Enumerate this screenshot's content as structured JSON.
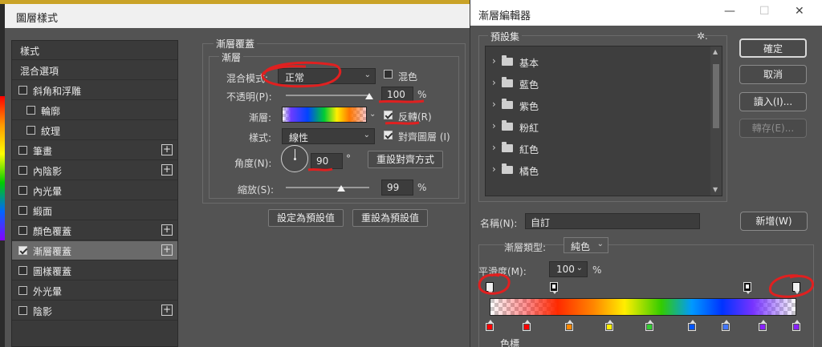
{
  "colors": {
    "accent_red": "#e02020",
    "checkbox_on": "#e8e8e8"
  },
  "layer_style": {
    "title": "圖層樣式",
    "styles_list": [
      {
        "label": "樣式",
        "checkbox": false,
        "indent": false,
        "has_checkbox": false,
        "plus": false,
        "selected": false
      },
      {
        "label": "混合選項",
        "checkbox": false,
        "indent": false,
        "has_checkbox": false,
        "plus": false,
        "selected": false
      },
      {
        "label": "斜角和浮雕",
        "checkbox": false,
        "indent": false,
        "has_checkbox": true,
        "plus": false,
        "selected": false
      },
      {
        "label": "輪廓",
        "checkbox": false,
        "indent": true,
        "has_checkbox": true,
        "plus": false,
        "selected": false
      },
      {
        "label": "紋理",
        "checkbox": false,
        "indent": true,
        "has_checkbox": true,
        "plus": false,
        "selected": false
      },
      {
        "label": "筆畫",
        "checkbox": false,
        "indent": false,
        "has_checkbox": true,
        "plus": true,
        "selected": false
      },
      {
        "label": "內陰影",
        "checkbox": false,
        "indent": false,
        "has_checkbox": true,
        "plus": true,
        "selected": false
      },
      {
        "label": "內光暈",
        "checkbox": false,
        "indent": false,
        "has_checkbox": true,
        "plus": false,
        "selected": false
      },
      {
        "label": "緞面",
        "checkbox": false,
        "indent": false,
        "has_checkbox": true,
        "plus": false,
        "selected": false
      },
      {
        "label": "顏色覆蓋",
        "checkbox": false,
        "indent": false,
        "has_checkbox": true,
        "plus": true,
        "selected": false
      },
      {
        "label": "漸層覆蓋",
        "checkbox": true,
        "indent": false,
        "has_checkbox": true,
        "plus": true,
        "selected": true
      },
      {
        "label": "圖樣覆蓋",
        "checkbox": false,
        "indent": false,
        "has_checkbox": true,
        "plus": false,
        "selected": false
      },
      {
        "label": "外光暈",
        "checkbox": false,
        "indent": false,
        "has_checkbox": true,
        "plus": false,
        "selected": false
      },
      {
        "label": "陰影",
        "checkbox": false,
        "indent": false,
        "has_checkbox": true,
        "plus": true,
        "selected": false
      }
    ],
    "section_title": "漸層覆蓋",
    "group_title": "漸層",
    "blend_mode_label": "混合模式:",
    "blend_mode_value": "正常",
    "dither_label": "混色",
    "dither_checked": false,
    "opacity_label": "不透明(P):",
    "opacity_value": "100",
    "opacity_fraction": 1.0,
    "percent": "%",
    "gradient_label": "漸層:",
    "reverse_label": "反轉(R)",
    "reverse_checked": true,
    "style_label": "樣式:",
    "style_value": "線性",
    "align_label": "對齊圖層 (I)",
    "align_checked": true,
    "angle_label": "角度(N):",
    "angle_value": "90",
    "degree": "°",
    "reset_align_button": "重設對齊方式",
    "scale_label": "縮放(S):",
    "scale_value": "99",
    "scale_fraction": 0.66,
    "make_default_button": "設定為預設值",
    "reset_default_button": "重設為預設值"
  },
  "gradient_editor": {
    "title": "漸層編輯器",
    "presets_label": "預設集",
    "presets": [
      "基本",
      "藍色",
      "紫色",
      "粉紅",
      "紅色",
      "橘色"
    ],
    "ok_button": "確定",
    "cancel_button": "取消",
    "load_button": "讀入(I)...",
    "save_button": "轉存(E)...",
    "name_label": "名稱(N):",
    "name_value": "自訂",
    "new_button": "新增(W)",
    "type_label": "漸層類型:",
    "type_value": "純色",
    "smoothness_label": "平滑度(M):",
    "smoothness_value": "100",
    "percent": "%",
    "color_stops_label": "色標",
    "opacity_stops": [
      {
        "position": 0.0,
        "color": "#ffffff"
      },
      {
        "position": 0.21,
        "color": "#000000"
      },
      {
        "position": 0.84,
        "color": "#000000"
      },
      {
        "position": 1.0,
        "color": "#ffffff"
      }
    ],
    "color_stops": [
      {
        "position": 0.0,
        "color": "#ff0000"
      },
      {
        "position": 0.12,
        "color": "#ff0000"
      },
      {
        "position": 0.26,
        "color": "#ff8800"
      },
      {
        "position": 0.39,
        "color": "#ffee00"
      },
      {
        "position": 0.52,
        "color": "#33cc33"
      },
      {
        "position": 0.66,
        "color": "#0055ff"
      },
      {
        "position": 0.77,
        "color": "#4477ff"
      },
      {
        "position": 0.89,
        "color": "#8822ff"
      },
      {
        "position": 1.0,
        "color": "#8822ff"
      }
    ]
  }
}
